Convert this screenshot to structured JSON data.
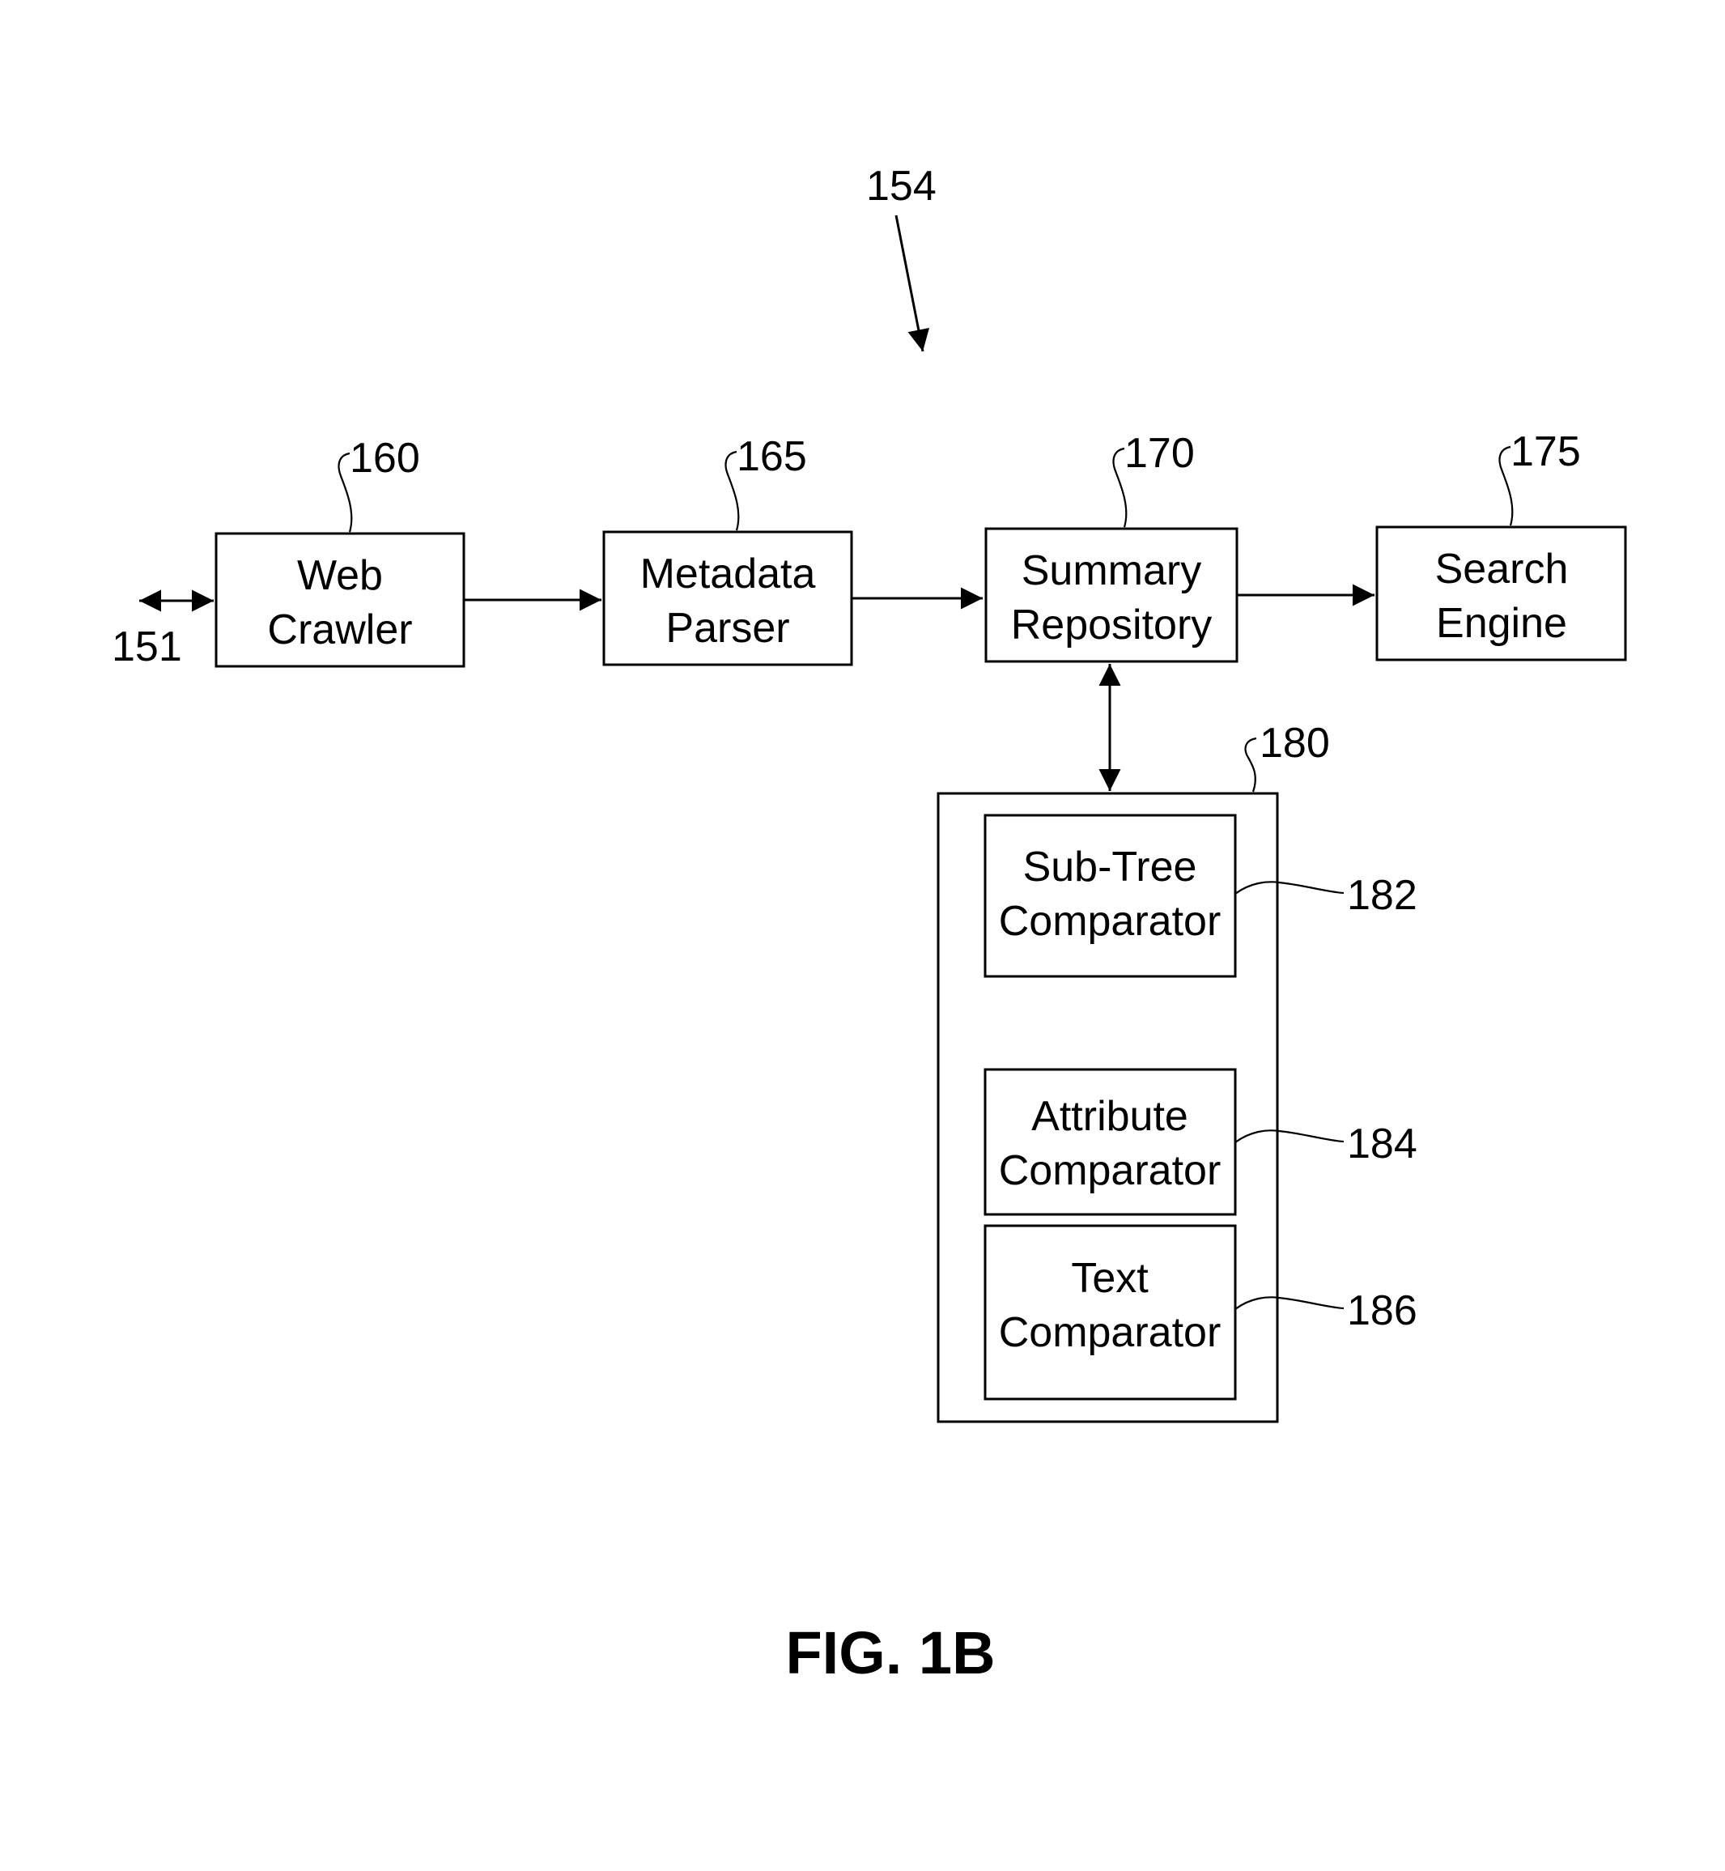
{
  "figure": {
    "title": "FIG. 1B",
    "system_ref": "154"
  },
  "external": {
    "ref": "151"
  },
  "blocks": [
    {
      "id": "web-crawler",
      "ref": "160",
      "lines": [
        "Web",
        "Crawler"
      ]
    },
    {
      "id": "metadata-parser",
      "ref": "165",
      "lines": [
        "Metadata",
        "Parser"
      ]
    },
    {
      "id": "summary-repository",
      "ref": "170",
      "lines": [
        "Summary",
        "Repository"
      ]
    },
    {
      "id": "search-engine",
      "ref": "175",
      "lines": [
        "Search",
        "Engine"
      ]
    }
  ],
  "comparator_group": {
    "ref": "180",
    "components": [
      {
        "id": "sub-tree-comparator",
        "ref": "182",
        "lines": [
          "Sub-Tree",
          "Comparator"
        ]
      },
      {
        "id": "attribute-comparator",
        "ref": "184",
        "lines": [
          "Attribute",
          "Comparator"
        ]
      },
      {
        "id": "text-comparator",
        "ref": "186",
        "lines": [
          "Text",
          "Comparator"
        ]
      }
    ]
  },
  "connections": [
    {
      "from": "external-151",
      "to": "web-crawler",
      "direction": "bidirectional"
    },
    {
      "from": "web-crawler",
      "to": "metadata-parser",
      "direction": "forward"
    },
    {
      "from": "metadata-parser",
      "to": "summary-repository",
      "direction": "forward"
    },
    {
      "from": "summary-repository",
      "to": "search-engine",
      "direction": "forward"
    },
    {
      "from": "summary-repository",
      "to": "comparator-group-180",
      "direction": "bidirectional"
    }
  ]
}
